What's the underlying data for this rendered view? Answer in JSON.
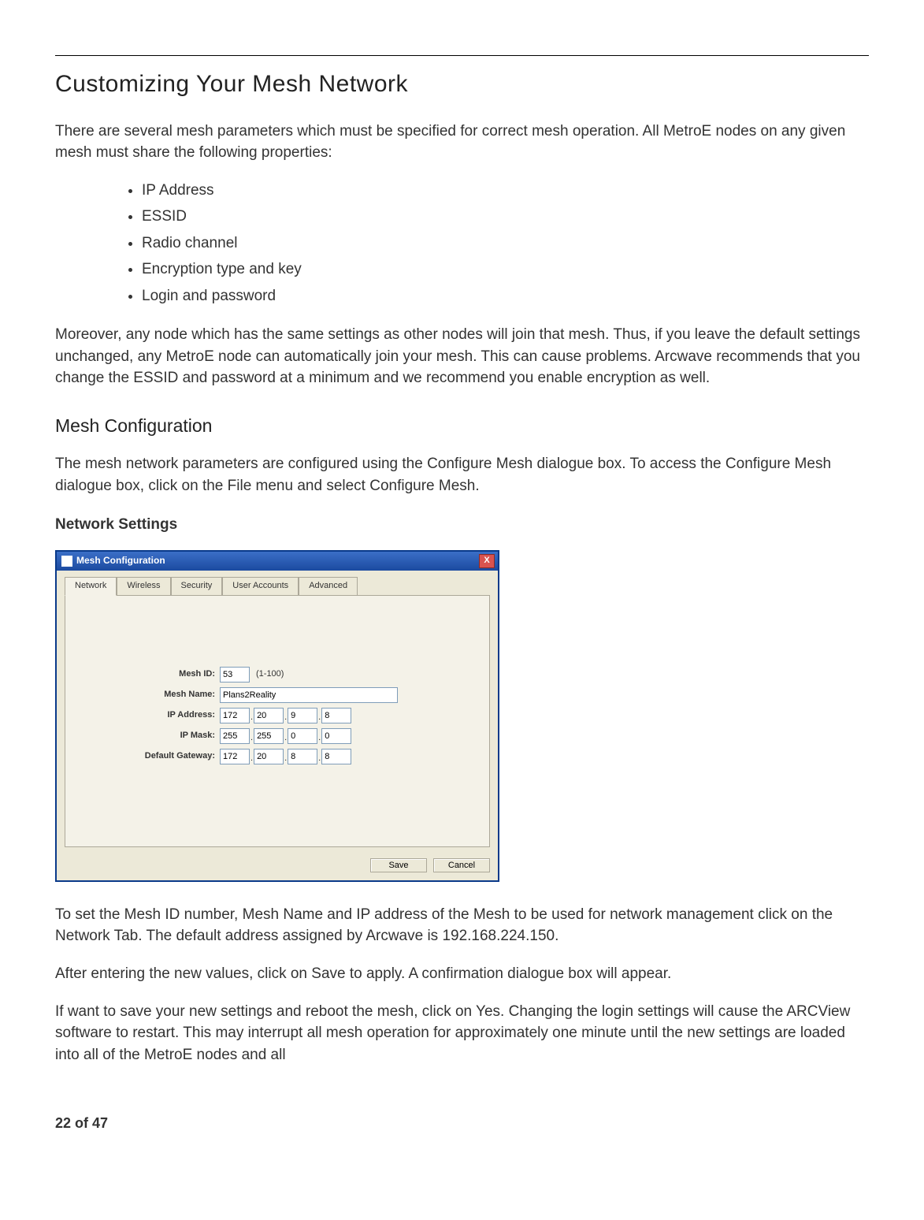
{
  "heading": "Customizing Your Mesh Network",
  "intro": "There are several mesh parameters which must be specified for correct mesh operation. All MetroE nodes on any given mesh must share the following properties:",
  "bullets": [
    "IP Address",
    "ESSID",
    "Radio channel",
    "Encryption type and key",
    "Login and password"
  ],
  "para_moreover": "Moreover, any node which has the same settings as other nodes will join that mesh. Thus, if you leave the default settings unchanged, any MetroE node can automatically join your mesh. This can cause problems. Arcwave recommends that you change the ESSID and password at a minimum and we recommend you enable encryption as well.",
  "section_mesh_config": "Mesh Configuration",
  "para_mesh_config": "The mesh network parameters are configured using the Configure Mesh dialogue box. To access the Configure Mesh dialogue box, click on the File menu and select Configure Mesh.",
  "subsection_network": "Network Settings",
  "dialog": {
    "title": "Mesh Configuration",
    "close_glyph": "X",
    "tabs": [
      "Network",
      "Wireless",
      "Security",
      "User Accounts",
      "Advanced"
    ],
    "labels": {
      "mesh_id": "Mesh ID:",
      "mesh_id_hint": "(1-100)",
      "mesh_name": "Mesh Name:",
      "ip_address": "IP Address:",
      "ip_mask": "IP Mask:",
      "default_gateway": "Default Gateway:"
    },
    "values": {
      "mesh_id": "53",
      "mesh_name": "Plans2Reality",
      "ip_address": [
        "172",
        "20",
        "9",
        "8"
      ],
      "ip_mask": [
        "255",
        "255",
        "0",
        "0"
      ],
      "default_gateway": [
        "172",
        "20",
        "8",
        "8"
      ]
    },
    "buttons": {
      "save": "Save",
      "cancel": "Cancel"
    }
  },
  "para_after_dialog_1": "To set the Mesh ID number, Mesh Name and IP address of the Mesh to be used for network management click on the Network Tab. The default address assigned by Arcwave is 192.168.224.150.",
  "para_after_dialog_2": "After entering the new values, click on Save to apply. A confirmation dialogue box will appear.",
  "para_after_dialog_3": "If want to save your new settings and reboot the mesh, click on Yes. Changing the login settings will cause the ARCView software to restart. This may interrupt all mesh operation for approximately one minute until the new settings are loaded into all of the MetroE nodes and all",
  "page_number": "22 of 47"
}
